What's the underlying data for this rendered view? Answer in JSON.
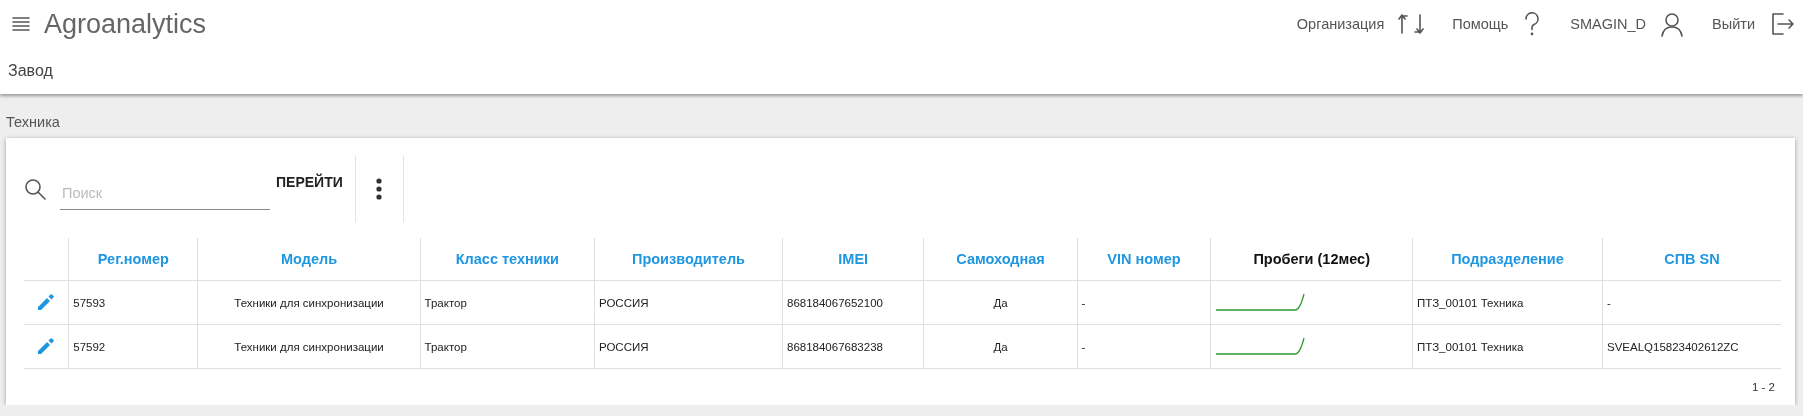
{
  "app": {
    "title": "Agroanalytics"
  },
  "nav": [
    {
      "kind": "org",
      "label": "Организация"
    },
    {
      "kind": "help",
      "label": "Помощь"
    },
    {
      "kind": "user",
      "label": "SMAGIN_D"
    },
    {
      "kind": "logout",
      "label": "Выйти"
    }
  ],
  "subtitle": "Завод",
  "breadcrumb": "Техника",
  "search": {
    "placeholder": "Поиск",
    "button": "ПЕРЕЙТИ"
  },
  "table": {
    "columns": [
      {
        "label": "Рег.номер",
        "sortable": true
      },
      {
        "label": "Модель",
        "sortable": true
      },
      {
        "label": "Класс техники",
        "sortable": true
      },
      {
        "label": "Производитель",
        "sortable": true
      },
      {
        "label": "IMEI",
        "sortable": true
      },
      {
        "label": "Самоходная",
        "sortable": true
      },
      {
        "label": "VIN номер",
        "sortable": true
      },
      {
        "label": "Пробеги (12мес)",
        "sortable": false
      },
      {
        "label": "Подразделение",
        "sortable": true
      },
      {
        "label": "СПВ SN",
        "sortable": true
      }
    ],
    "rows": [
      {
        "cells": [
          "57593",
          "Техники для синхронизации",
          "Трактор",
          "РОССИЯ",
          "868184067652100",
          "Да",
          "-",
          {
            "kind": "sparkline"
          },
          "ПТЗ_00101 Техника",
          "-"
        ]
      },
      {
        "cells": [
          "57592",
          "Техники для синхронизации",
          "Трактор",
          "РОССИЯ",
          "868184067683238",
          "Да",
          "-",
          {
            "kind": "sparkline"
          },
          "ПТЗ_00101 Техника",
          "SVEALQ15823402612ZC"
        ]
      }
    ],
    "pagination": "1 - 2"
  }
}
